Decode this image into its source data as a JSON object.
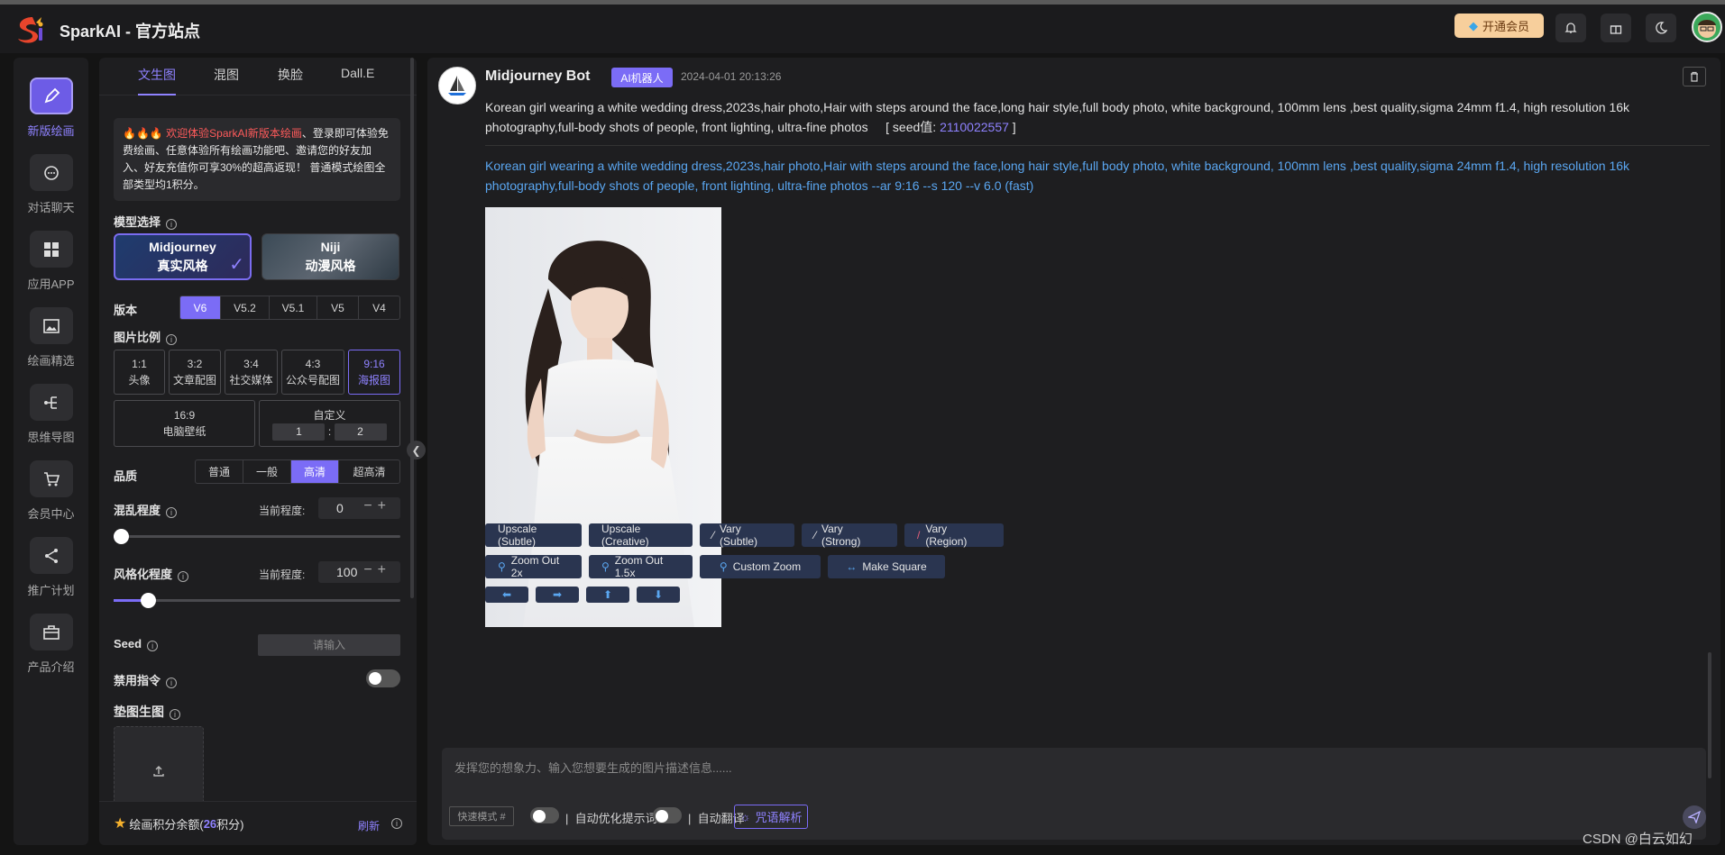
{
  "header": {
    "site_title": "SparkAI - 官方站点",
    "vip_label": "开通会员",
    "icons": [
      "bell-icon",
      "gift-icon",
      "moon-icon"
    ]
  },
  "sidebar": {
    "items": [
      {
        "label": "新版绘画",
        "icon": "pen-icon",
        "active": true
      },
      {
        "label": "对话聊天",
        "icon": "chat-icon"
      },
      {
        "label": "应用APP",
        "icon": "grid-icon"
      },
      {
        "label": "绘画精选",
        "icon": "image-icon"
      },
      {
        "label": "思维导图",
        "icon": "mindmap-icon"
      },
      {
        "label": "会员中心",
        "icon": "cart-icon"
      },
      {
        "label": "推广计划",
        "icon": "share-icon"
      },
      {
        "label": "产品介绍",
        "icon": "briefcase-icon"
      }
    ]
  },
  "panel": {
    "tabs": [
      "文生图",
      "混图",
      "换脸",
      "Dall.E"
    ],
    "notice_highlight": "欢迎体验SparkAI新版本绘画",
    "notice_text": "、登录即可体验免费绘画、任意体验所有绘画功能吧、邀请您的好友加入、好友充值你可享30%的超高返现！ 普通模式绘图全部类型均1积分。",
    "model_label": "模型选择",
    "models": [
      {
        "name": "Midjourney",
        "sub": "真实风格"
      },
      {
        "name": "Niji",
        "sub": "动漫风格"
      }
    ],
    "version_label": "版本",
    "versions": [
      "V6",
      "V5.2",
      "V5.1",
      "V5",
      "V4"
    ],
    "ratio_label": "图片比例",
    "ratios": [
      {
        "r": "1:1",
        "d": "头像"
      },
      {
        "r": "3:2",
        "d": "文章配图"
      },
      {
        "r": "3:4",
        "d": "社交媒体"
      },
      {
        "r": "4:3",
        "d": "公众号配图"
      },
      {
        "r": "9:16",
        "d": "海报图"
      }
    ],
    "ratio_wide": {
      "r": "16:9",
      "d": "电脑壁纸"
    },
    "custom": {
      "label": "自定义",
      "w": "1",
      "sep": ":",
      "h": "2"
    },
    "quality_label": "品质",
    "qualities": [
      "普通",
      "一般",
      "高清",
      "超高清"
    ],
    "chaos_label": "混乱程度",
    "current_label": "当前程度:",
    "chaos_value": "0",
    "chaos_fraction": 0.0,
    "stylize_label": "风格化程度",
    "stylize_value": "100",
    "stylize_fraction": 0.1,
    "seed_label": "Seed",
    "seed_placeholder": "请输入",
    "no_label": "禁用指令",
    "ref_label": "垫图生图",
    "footer_prefix": "绘画积分余额(",
    "footer_points": "26",
    "footer_suffix": "积分)",
    "refresh": "刷新"
  },
  "message": {
    "bot_name": "Midjourney Bot",
    "badge": "AI机器人",
    "time": "2024-04-01 20:13:26",
    "prompt": "Korean girl wearing a white wedding dress,2023s,hair photo,Hair with steps around the face,long hair style,full body photo, white background, 100mm lens ,best quality,sigma 24mm f1.4, high resolution 16k photography,full-body shots of people, front lighting, ultra-fine photos",
    "seed_prefix": "[ seed值: ",
    "seed_value": "2110022557",
    "seed_suffix": " ]",
    "full_prompt": "Korean girl wearing a white wedding dress,2023s,hair photo,Hair with steps around the face,long hair style,full body photo, white background, 100mm lens ,best quality,sigma 24mm f1.4, high resolution 16k photography,full-body shots of people, front lighting, ultra-fine photos --ar 9:16 --s 120 --v 6.0  (fast)",
    "actions_row1": [
      "Upscale (Subtle)",
      "Upscale (Creative)",
      "Vary (Subtle)",
      "Vary (Strong)",
      "Vary (Region)"
    ],
    "actions_row2": [
      "Zoom Out 2x",
      "Zoom Out 1.5x",
      "Custom Zoom",
      "Make Square"
    ],
    "arrows": [
      "⬅",
      "➡",
      "⬆",
      "⬇"
    ]
  },
  "composer": {
    "placeholder": "发挥您的想象力、输入您想要生成的图片描述信息......",
    "mode": "快速模式 #",
    "opt1": "自动优化提示词",
    "opt2": "自动翻译",
    "parse": "咒语解析"
  },
  "watermark": "CSDN @白云如幻",
  "colors": {
    "accent": "#7b6cf6",
    "link": "#5aa6f0",
    "vip": "#f7cf9c"
  }
}
